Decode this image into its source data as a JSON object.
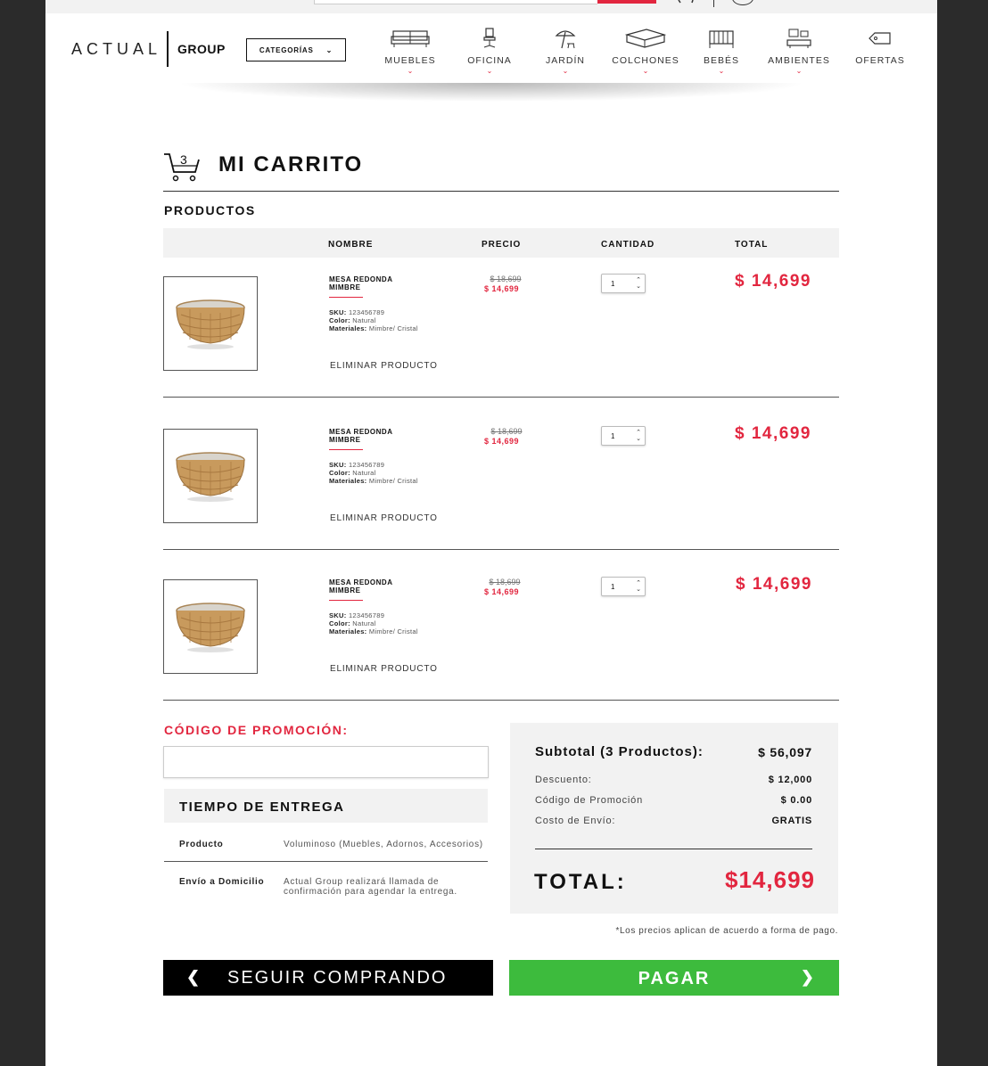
{
  "brand": {
    "logo_left": "ACTUAL",
    "logo_right": "GROUP"
  },
  "header": {
    "categories_label": "CATEGORÍAS",
    "nav": [
      {
        "label": "MUEBLES",
        "icon": "sofa-icon"
      },
      {
        "label": "OFICINA",
        "icon": "office-chair-icon"
      },
      {
        "label": "JARDÍN",
        "icon": "umbrella-icon"
      },
      {
        "label": "COLCHONES",
        "icon": "mattress-icon"
      },
      {
        "label": "BEBÉS",
        "icon": "crib-icon"
      },
      {
        "label": "AMBIENTES",
        "icon": "room-icon"
      },
      {
        "label": "OFERTAS",
        "icon": "tag-icon"
      }
    ]
  },
  "cart": {
    "title": "MI CARRITO",
    "count": "3",
    "section": "PRODUCTOS",
    "columns": {
      "name": "NOMBRE",
      "price": "PRECIO",
      "qty": "CANTIDAD",
      "total": "TOTAL"
    },
    "items": [
      {
        "name": "MESA REDONDA MIMBRE",
        "sku_label": "SKU:",
        "sku": "123456789",
        "color_label": "Color:",
        "color": "Natural",
        "materials_label": "Materiales:",
        "materials": "Mimbre/ Cristal",
        "old_price": "$ 18,699",
        "price": "$ 14,699",
        "qty": "1",
        "total": "$ 14,699",
        "remove": "ELIMINAR PRODUCTO"
      },
      {
        "name": "MESA REDONDA MIMBRE",
        "sku_label": "SKU:",
        "sku": "123456789",
        "color_label": "Color:",
        "color": "Natural",
        "materials_label": "Materiales:",
        "materials": "Mimbre/ Cristal",
        "old_price": "$ 18,699",
        "price": "$ 14,699",
        "qty": "1",
        "total": "$ 14,699",
        "remove": "ELIMINAR PRODUCTO"
      },
      {
        "name": "MESA REDONDA MIMBRE",
        "sku_label": "SKU:",
        "sku": "123456789",
        "color_label": "Color:",
        "color": "Natural",
        "materials_label": "Materiales:",
        "materials": "Mimbre/ Cristal",
        "old_price": "$ 18,699",
        "price": "$ 14,699",
        "qty": "1",
        "total": "$ 14,699",
        "remove": "ELIMINAR PRODUCTO"
      }
    ]
  },
  "promo": {
    "label": "CÓDIGO DE PROMOCIÓN:",
    "value": ""
  },
  "delivery": {
    "title": "TIEMPO DE ENTREGA",
    "rows": [
      {
        "key": "Producto",
        "value": "Voluminoso (Muebles, Adornos, Accesorios)"
      },
      {
        "key": "Envío a Domicilio",
        "value": "Actual Group realizará llamada de confirmación para agendar la entrega."
      }
    ]
  },
  "summary": {
    "subtotal_label": "Subtotal (3 Productos):",
    "subtotal": "$ 56,097",
    "discount_label": "Descuento:",
    "discount": "$ 12,000",
    "promo_label": "Código de Promoción",
    "promo": "$ 0.00",
    "shipping_label": "Costo de Envío:",
    "shipping": "GRATIS",
    "total_label": "TOTAL:",
    "total": "$14,699",
    "note": "*Los precios aplican de acuerdo a forma de pago."
  },
  "actions": {
    "continue_label": "SEGUIR COMPRANDO",
    "pay_label": "PAGAR"
  },
  "colors": {
    "accent": "#e2263f",
    "pay": "#3dbb3d",
    "panel": "#f2f2f2"
  }
}
